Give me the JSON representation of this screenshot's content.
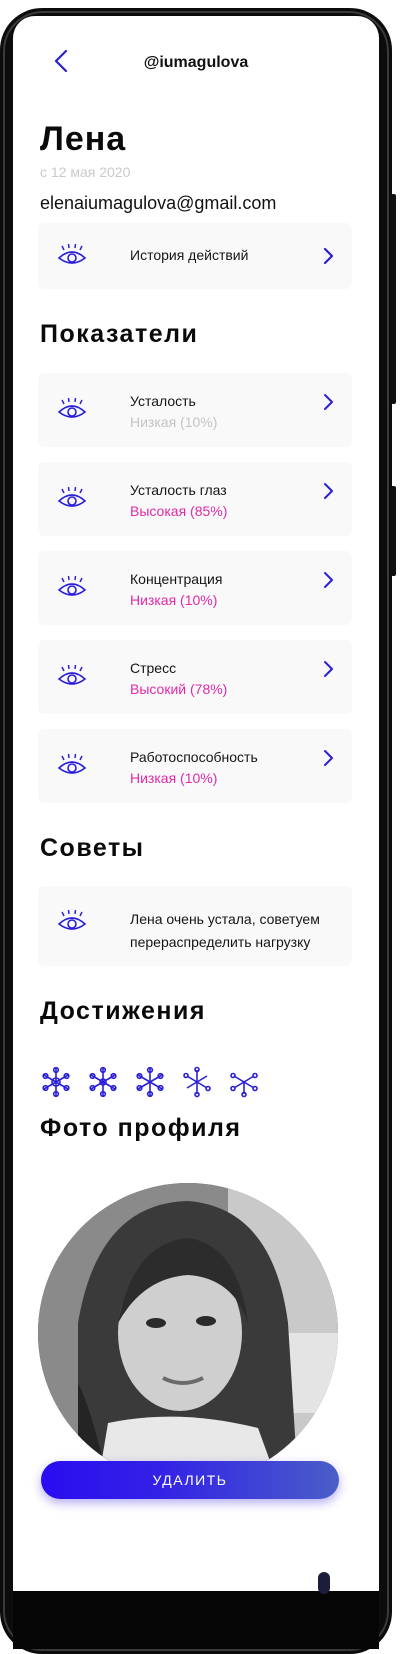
{
  "header": {
    "username": "@iumagulova"
  },
  "profile": {
    "name": "Лена",
    "since": "с 12 мая 2020",
    "email": "elenaiumagulova@gmail.com"
  },
  "history": {
    "label": "История действий"
  },
  "indicators": {
    "title": "Показатели",
    "items": [
      {
        "title": "Усталость",
        "status": "Низкая (10%)",
        "status_color": "#c4c4c4"
      },
      {
        "title": "Усталость глаз",
        "status": "Высокая (85%)",
        "status_color": "#e02aa8"
      },
      {
        "title": "Концентрация",
        "status": "Низкая (10%)",
        "status_color": "#e02aa8"
      },
      {
        "title": "Стресс",
        "status": "Высокий (78%)",
        "status_color": "#e02aa8"
      },
      {
        "title": "Работоспособность",
        "status": "Низкая (10%)",
        "status_color": "#e02aa8"
      }
    ]
  },
  "advice": {
    "title": "Советы",
    "text": "Лена очень устала, советуем перераспределить нагрузку"
  },
  "achievements": {
    "title": "Достижения",
    "icons": [
      "snowflake-icon",
      "snowflake-icon",
      "snowflake-icon",
      "snowflake-icon",
      "snowflake-icon"
    ]
  },
  "photo": {
    "title": "Фото профиля"
  },
  "actions": {
    "delete_label": "УДАЛИТЬ"
  },
  "colors": {
    "accent": "#2a1fd6",
    "highlight": "#e02aa8",
    "muted": "#c4c4c4",
    "card_bg": "#f9f9fa"
  }
}
